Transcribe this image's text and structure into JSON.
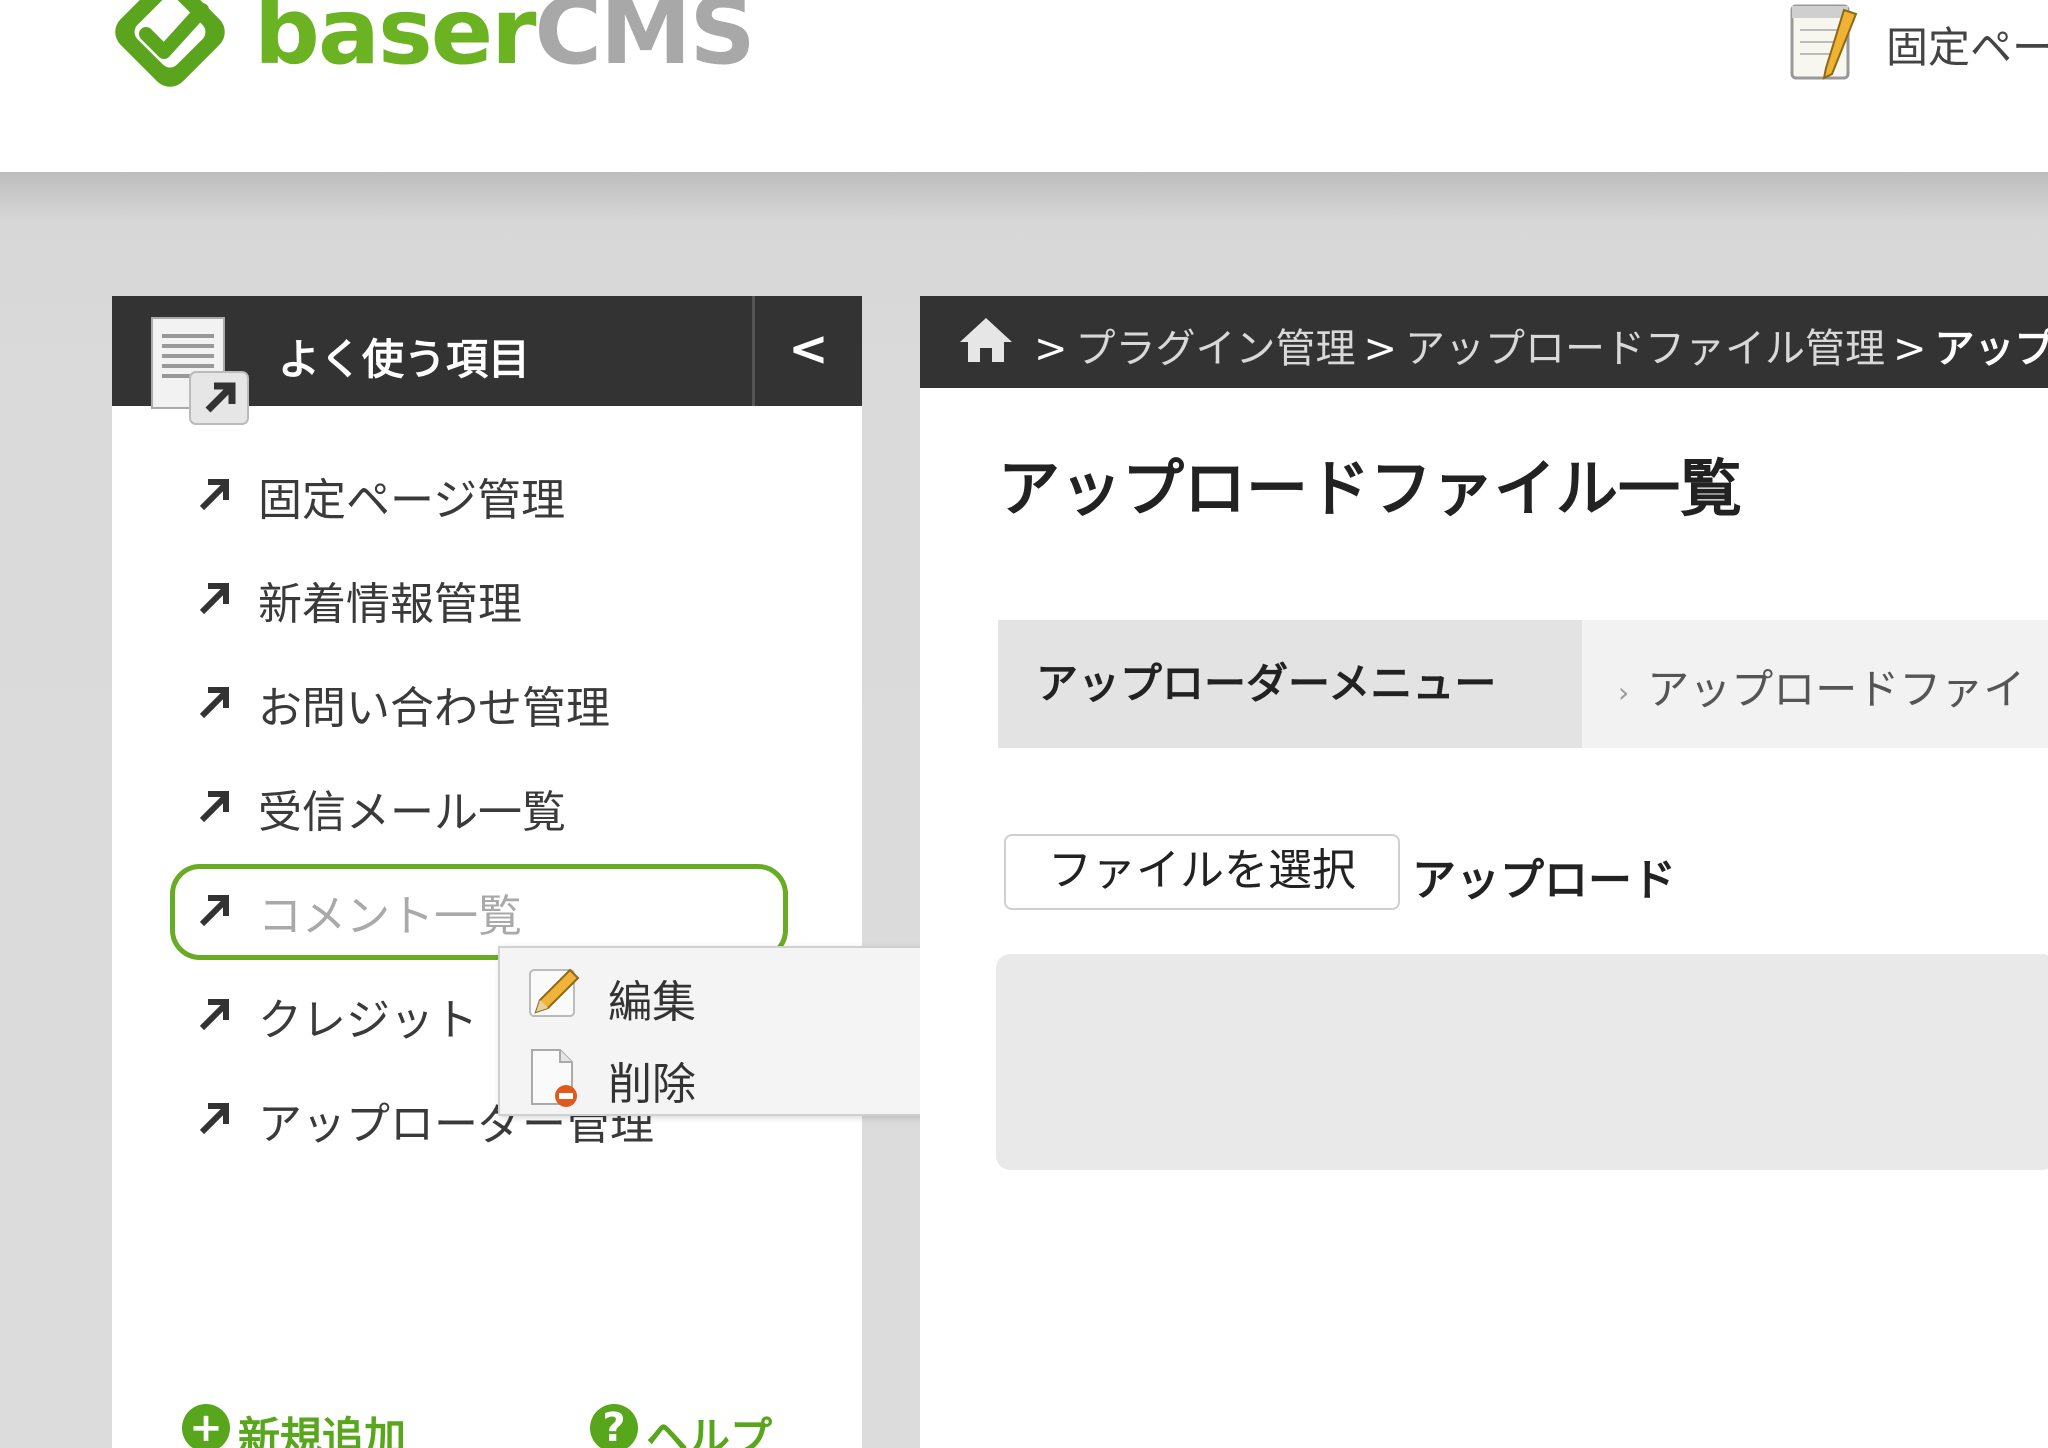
{
  "header": {
    "logo_primary": "baser",
    "logo_secondary": "CMS",
    "top_link": "固定ペー"
  },
  "sidebar": {
    "title": "よく使う項目",
    "collapse_label": "<",
    "items": [
      {
        "label": "固定ページ管理"
      },
      {
        "label": "新着情報管理"
      },
      {
        "label": "お問い合わせ管理"
      },
      {
        "label": "受信メール一覧"
      },
      {
        "label": "コメント一覧"
      },
      {
        "label": "クレジット"
      },
      {
        "label": "アップローダー管理"
      }
    ],
    "selected_index": 4,
    "footer": {
      "add_label": "新規追加",
      "help_label": "ヘルプ"
    }
  },
  "context_menu": {
    "items": [
      {
        "label": "編集",
        "icon": "pencil-icon"
      },
      {
        "label": "削除",
        "icon": "delete-doc-icon"
      }
    ]
  },
  "breadcrumb": {
    "items": [
      "プラグイン管理",
      "アップロードファイル管理"
    ],
    "current": "アップ",
    "separator": ">"
  },
  "main": {
    "title": "アップロードファイル一覧",
    "submenu_title": "アップローダーメニュー",
    "submenu_link": "アップロードファイ",
    "file_select_label": "ファイルを選択",
    "upload_label": "アップロード"
  },
  "colors": {
    "brand_green": "#6bb323",
    "dark_bar": "#333333",
    "highlight_border": "#69ab23"
  }
}
